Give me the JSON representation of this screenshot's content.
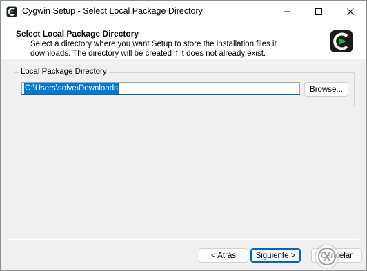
{
  "window": {
    "title": "Cygwin Setup - Select Local Package Directory",
    "caption_buttons": [
      "minimize-icon",
      "maximize-icon",
      "close-icon"
    ]
  },
  "header": {
    "title": "Select Local Package Directory",
    "description_line1": "Select a directory where you want Setup to store the installation files it",
    "description_line2": "downloads.  The directory will be created if it does not already exist."
  },
  "local_package": {
    "group_label": "Local Package Directory",
    "path_value": "C:\\Users\\solve\\Downloads",
    "browse_label": "Browse..."
  },
  "footer": {
    "back_label": "< Atrás",
    "next_label": "Siguiente >",
    "cancel_label": "Cancelar"
  },
  "colors": {
    "accent": "#0067c0",
    "selection": "#0078d7",
    "cygwin_green": "#2ca83c",
    "window_bg": "#f0f0f0"
  }
}
